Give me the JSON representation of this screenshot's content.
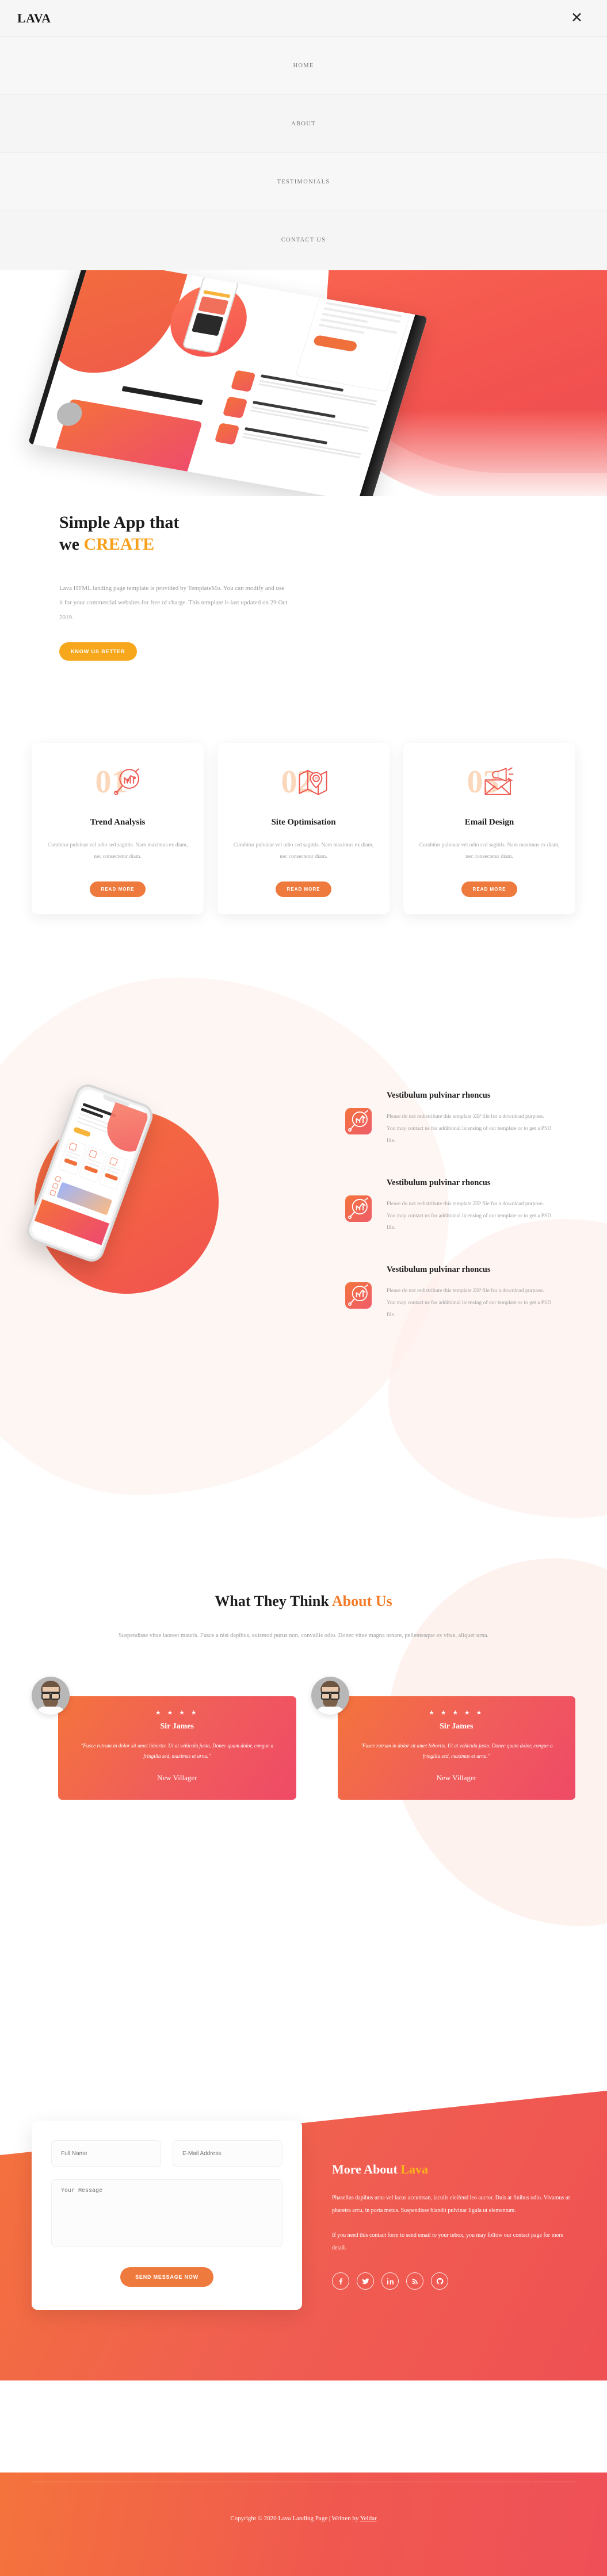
{
  "header": {
    "brand": "LAVA",
    "close_icon": "close-icon",
    "nav": [
      {
        "label": "HOME"
      },
      {
        "label": "ABOUT"
      },
      {
        "label": "TESTIMONIALS"
      },
      {
        "label": "CONTACT US"
      }
    ]
  },
  "about": {
    "title_line1": "Simple App that",
    "title_line2_pre": "we ",
    "title_line2_accent": "CREATE",
    "description": "Lava HTML landing page template is provided by TemplateMo. You can modify and use it for your commercial websites for free of charge. This template is last updated on 29 Oct 2019.",
    "cta_label": "KNOW US BETTER"
  },
  "feature_cards": [
    {
      "number": "01",
      "icon": "trend-analysis-icon",
      "title": "Trend Analysis",
      "desc": "Curabitur pulvinar vel odio sed sagittis. Nam maximus ex diam, nec consectetur diam.",
      "button": "READ MORE"
    },
    {
      "number": "02",
      "icon": "map-location-icon",
      "title": "Site Optimisation",
      "desc": "Curabitur pulvinar vel odio sed sagittis. Nam maximus ex diam, nec consectetur diam.",
      "button": "READ MORE"
    },
    {
      "number": "03",
      "icon": "email-megaphone-icon",
      "title": "Email Design",
      "desc": "Curabitur pulvinar vel odio sed sagittis. Nam maximus ex diam, nec consectetur diam.",
      "button": "READ MORE"
    }
  ],
  "services": [
    {
      "icon": "search-analysis-icon",
      "title": "Vestibulum pulvinar rhoncus",
      "desc": "Please do not redistribute this template ZIP file for a download purpose. You may contact us for additional licensing of our template or to get a PSD file."
    },
    {
      "icon": "search-analysis-icon",
      "title": "Vestibulum pulvinar rhoncus",
      "desc": "Please do not redistribute this template ZIP file for a download purpose. You may contact us for additional licensing of our template or to get a PSD file."
    },
    {
      "icon": "search-analysis-icon",
      "title": "Vestibulum pulvinar rhoncus",
      "desc": "Please do not redistribute this template ZIP file for a download purpose. You may contact us for additional licensing of our template or to get a PSD file."
    }
  ],
  "testimonials": {
    "title_main": "What They Think ",
    "title_accent": "About Us",
    "subtitle": "Suspendisse vitae laoreet mauris. Fusce a nisi dapibus, euismod purus non, convallis odio. Donec vitae magna ornare, pellentesque ex vitae, aliquet urna.",
    "items": [
      {
        "stars": "★ ★ ★ ★",
        "name": "Sir James",
        "quote": "\"Fusce rutrum in dolor sit amet lobortis. Ut at vehicula justo. Donec quam dolor, congue a fringilla sed, maximus et urna.\"",
        "role": "New Villager"
      },
      {
        "stars": "★ ★ ★ ★ ★",
        "name": "Sir James",
        "quote": "\"Fusce rutrum in dolor sit amet lobortis. Ut at vehicula justo. Donec quam dolor, congue a fringilla sed, maximus et urna.\"",
        "role": "New Villager"
      }
    ]
  },
  "contact": {
    "form": {
      "name_placeholder": "Full Name",
      "email_placeholder": "E-Mail Address",
      "message_placeholder": "Your Message",
      "submit_label": "SEND MESSAGE NOW"
    },
    "heading_main": "More About ",
    "heading_accent": "Lava",
    "paragraph1": "Phasellus dapibus urna vel lacus accumsan, iaculis eleifend leo auctor. Duis at finibus odio. Vivamus ut pharetra arcu, in porta metus. Suspendisse blandit pulvinar ligula ut elementum.",
    "paragraph2": "If you need this contact form to send email to your inbox, you may follow our contact page for more detail.",
    "social": [
      {
        "name": "facebook-icon"
      },
      {
        "name": "twitter-icon"
      },
      {
        "name": "linkedin-icon"
      },
      {
        "name": "rss-icon"
      },
      {
        "name": "github-icon"
      }
    ]
  },
  "footer": {
    "copyright_pre": "Copyright © 2020 Lava Landing Page | Written by ",
    "author": "Yeldar"
  },
  "colors": {
    "accent_yellow": "#f7a01c",
    "accent_orange": "#ef7a3d",
    "gradient_start": "#f4733c",
    "gradient_end": "#ef5052"
  }
}
